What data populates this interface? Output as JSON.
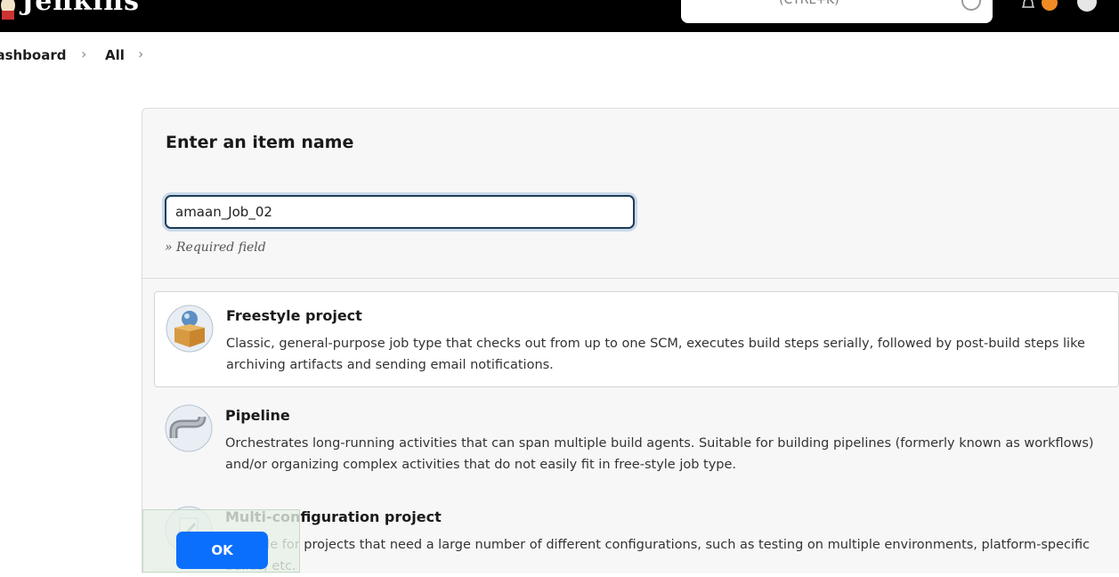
{
  "header": {
    "logo_text": "Jenkins",
    "search_shortcut": "(CTRL+K)"
  },
  "breadcrumb": {
    "items": [
      "Dashboard",
      "All"
    ]
  },
  "form": {
    "title": "Enter an item name",
    "item_name_value": "amaan_Job_02",
    "required_note": "» Required field"
  },
  "project_types": [
    {
      "title": "Freestyle project",
      "description": "Classic, general-purpose job type that checks out from up to one SCM, executes build steps serially, followed by post-build steps like archiving artifacts and sending email notifications."
    },
    {
      "title": "Pipeline",
      "description": "Orchestrates long-running activities that can span multiple build agents. Suitable for building pipelines (formerly known as workflows) and/or organizing complex activities that do not easily fit in free-style job type."
    },
    {
      "title": "Multi-configuration project",
      "description": "Suitable for projects that need a large number of different configurations, such as testing on multiple environments, platform-specific builds, etc."
    }
  ],
  "actions": {
    "ok_label": "OK"
  },
  "colors": {
    "header_bg": "#000000",
    "primary_button": "#0b6ffd",
    "input_border": "#1d3c57"
  }
}
